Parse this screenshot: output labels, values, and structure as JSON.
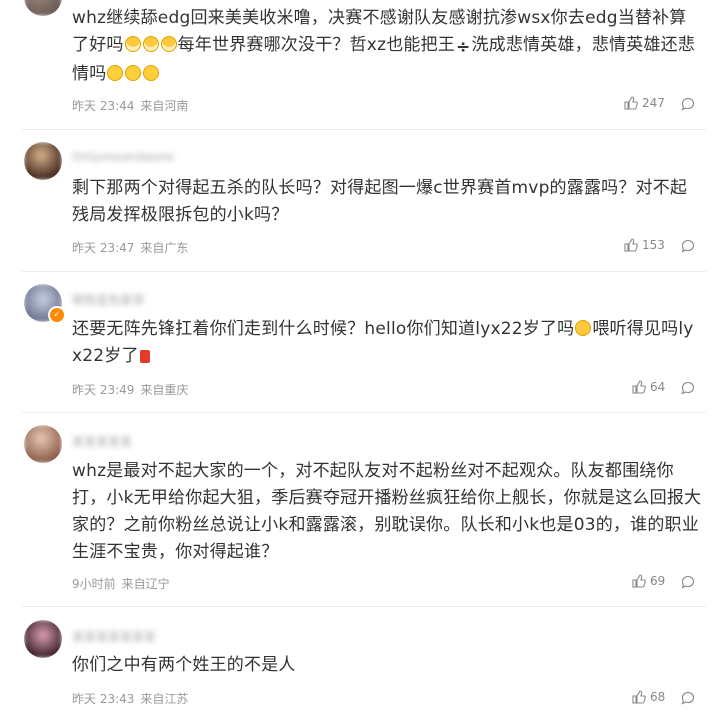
{
  "comments": [
    {
      "username": "user",
      "text_parts": [
        "whz继续舔edg回来美美收米噜，决赛不感谢队友感谢抗渗wsx你去edg当替补算了好吗",
        "每年世界赛哪次没干？哲xz也能把王",
        "洗成悲情英雄，悲情英雄还悲情吗"
      ],
      "divide_symbol": "÷",
      "time": "昨天 23:44",
      "location": "来自河南",
      "likes": "247"
    },
    {
      "username": "Onlyoneandaone",
      "text": "剩下那两个对得起五杀的队长吗？对得起图一爆c世界赛首mvp的露露吗？对不起残局发挥极限拆包的小k吗？",
      "time": "昨天 23:47",
      "location": "来自广东",
      "likes": "153"
    },
    {
      "username": "钢铁蓝色星球",
      "text_parts": [
        "还要无阵先锋扛着你们走到什么时候？hello你们知道lyx22岁了吗",
        "喂听得见吗lyx22岁了"
      ],
      "time": "昨天 23:49",
      "location": "来自重庆",
      "likes": "64"
    },
    {
      "username": "某某某某某",
      "text": "whz是最对不起大家的一个，对不起队友对不起粉丝对不起观众。队友都围绕你打，小k无甲给你起大狙，季后赛夺冠开播粉丝疯狂给你上舰长，你就是这么回报大家的？之前你粉丝总说让小k和露露滚，别耽误你。队长和小k也是03的，谁的职业生涯不宝贵，你对得起谁？",
      "time": "9小时前",
      "location": "来自辽宁",
      "likes": "69"
    },
    {
      "username": "某某某某某某某",
      "text": "你们之中有两个姓王的不是人",
      "time": "昨天 23:43",
      "location": "来自江苏",
      "likes": "68"
    }
  ],
  "icons": {
    "like": "thumbs-up-icon",
    "reply": "comment-bubble-icon",
    "verified": "verified-badge-icon"
  },
  "colors": {
    "text": "#333333",
    "meta": "#999999",
    "divider": "#ededed",
    "badge": "#ff8a00"
  }
}
